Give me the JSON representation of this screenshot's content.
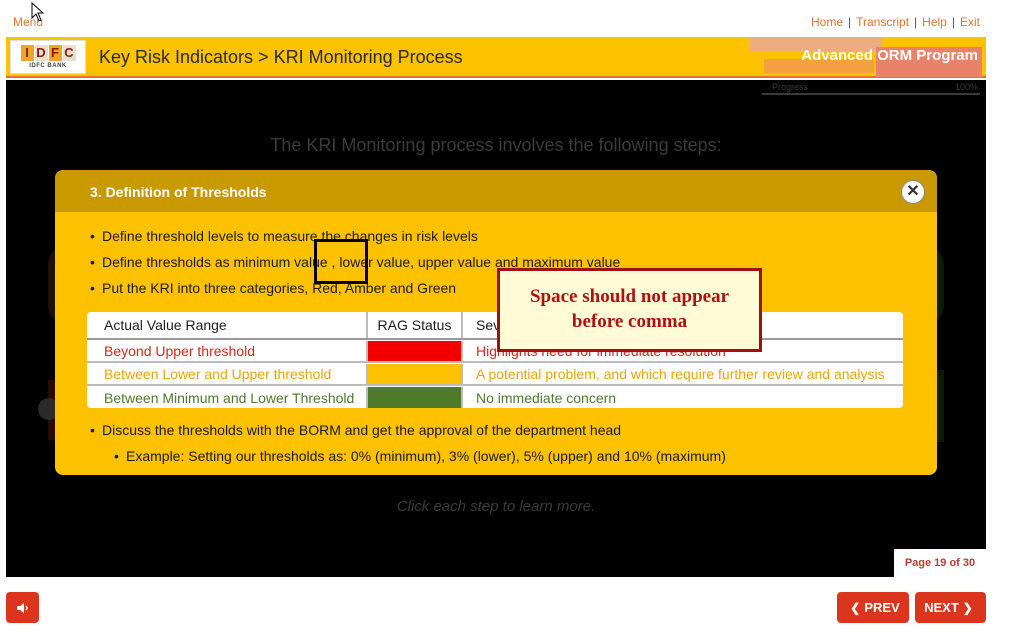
{
  "topbar": {
    "menu_label": "Menu",
    "links": [
      "Home",
      "Transcript",
      "Help",
      "Exit"
    ],
    "separator": "|"
  },
  "header": {
    "logo_letters": [
      "I",
      "D",
      "F",
      "C"
    ],
    "logo_sub": "IDFC BANK",
    "title": "Key Risk Indicators > KRI Monitoring Process",
    "program": "Advanced ORM Program",
    "progress_label": "Progress",
    "progress_value": "100%",
    "progress_fraction": 1.0
  },
  "stage": {
    "intro": "The KRI Monitoring process involves the following steps:",
    "hint": "Click each step to learn more.",
    "page_indicator": "Page 19 of 30"
  },
  "popup": {
    "title": "3. Definition of Thresholds",
    "close_icon": "close-icon",
    "bullets": [
      "Define threshold levels to measure the changes in risk levels",
      "Define thresholds as minimum value , lower value, upper value and maximum value",
      "Put the KRI into three categories, Red, Amber and Green",
      "Discuss the thresholds with the BORM and get the approval of the department head"
    ],
    "sub_bullet": "Example: Setting our thresholds as: 0% (minimum), 3% (lower), 5% (upper) and 10% (maximum)",
    "table": {
      "headers": [
        "Actual Value Range",
        "RAG Status",
        "Severity"
      ],
      "rows": [
        {
          "range": "Beyond Upper threshold",
          "color": "#f20000",
          "text_color": "#d9261c",
          "severity": "Highlights need for immediate resolution"
        },
        {
          "range": "Between Lower and Upper threshold",
          "color": "#fcc200",
          "text_color": "#f0a500",
          "severity": "A potential problem, and which require further review and analysis"
        },
        {
          "range": "Between Minimum and Lower Threshold",
          "color": "#4f7a2c",
          "text_color": "#4f7a2c",
          "severity": "No immediate concern"
        }
      ]
    }
  },
  "annotation": {
    "note": "Space should not appear before comma"
  },
  "footer": {
    "audio_icon": "speaker-icon",
    "prev_label": "PREV",
    "next_label": "NEXT"
  },
  "colors": {
    "accent": "#fcc200",
    "brand_orange": "#e8722a",
    "button_red": "#d9361d"
  }
}
